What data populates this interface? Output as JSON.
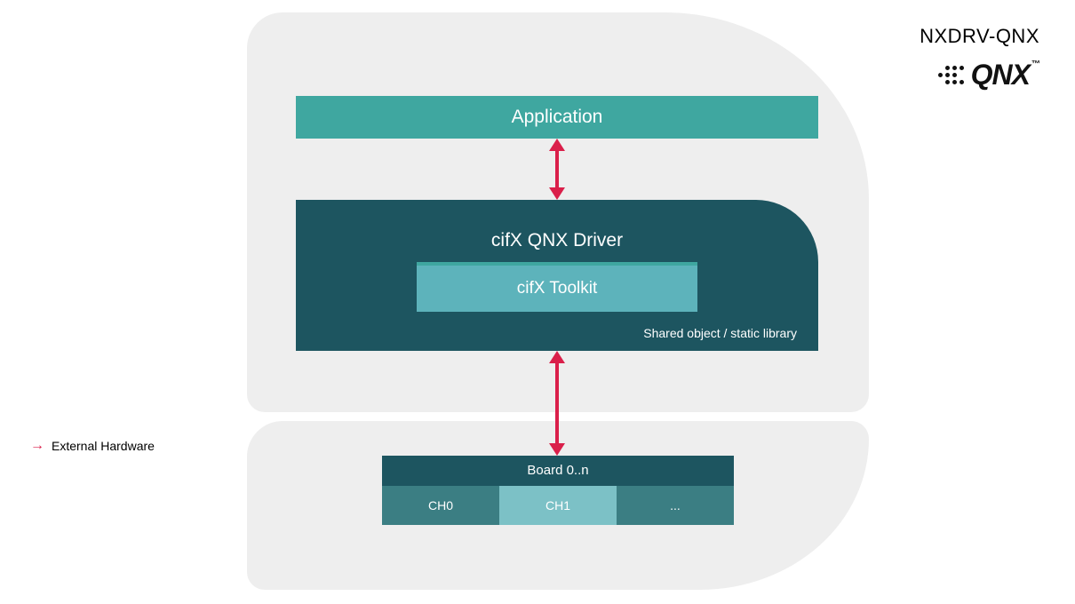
{
  "header": {
    "title": "NXDRV-QNX",
    "logo_text": "QNX",
    "logo_tm": "™"
  },
  "diagram": {
    "application_label": "Application",
    "driver": {
      "title": "cifX QNX Driver",
      "toolkit_label": "cifX Toolkit",
      "footer": "Shared object / static library"
    },
    "board": {
      "header": "Board 0..n",
      "channels": [
        "CH0",
        "CH1",
        "..."
      ]
    },
    "external_hw_label": "External Hardware"
  },
  "colors": {
    "panel_bg": "#eeeeee",
    "teal_light": "#3fa7a0",
    "teal_dark": "#1d5560",
    "toolkit": "#5db3bb",
    "channel_dark": "#3b7e83",
    "channel_light": "#7cc1c6",
    "accent_red": "#da1f4a"
  }
}
